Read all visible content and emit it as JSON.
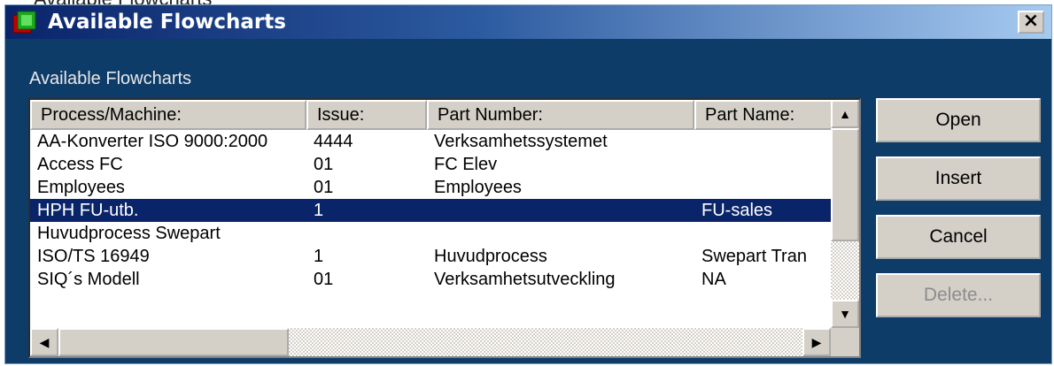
{
  "background_title": "Available Flowcharts",
  "window": {
    "title": "Available Flowcharts",
    "close_label": "×",
    "group_label": "Available Flowcharts"
  },
  "table": {
    "columns": [
      "Process/Machine:",
      "Issue:",
      "Part Number:",
      "Part Name:"
    ],
    "rows": [
      [
        "AA-Konverter ISO 9000:2000",
        "4444",
        "Verksamhetssystemet",
        ""
      ],
      [
        "Access FC",
        "01",
        "FC Elev",
        ""
      ],
      [
        "Employees",
        "01",
        "Employees",
        ""
      ],
      [
        "HPH FU-utb.",
        "1",
        "",
        "FU-sales"
      ],
      [
        "Huvudprocess Swepart",
        "",
        "",
        ""
      ],
      [
        "ISO/TS 16949",
        "1",
        "Huvudprocess",
        "Swepart Tran"
      ],
      [
        "SIQ´s Modell",
        "01",
        "Verksamhetsutveckling",
        "NA"
      ]
    ],
    "selected_row": 3
  },
  "buttons": {
    "open": "Open",
    "insert": "Insert",
    "cancel": "Cancel",
    "delete": "Delete..."
  },
  "scroll_arrows": {
    "up": "▲",
    "down": "▼",
    "left": "◀",
    "right": "▶"
  },
  "colors": {
    "window_bg": "#0e3c68",
    "titlebar_start": "#0a246a",
    "titlebar_end": "#a6caf0",
    "selection": "#0a246a"
  }
}
